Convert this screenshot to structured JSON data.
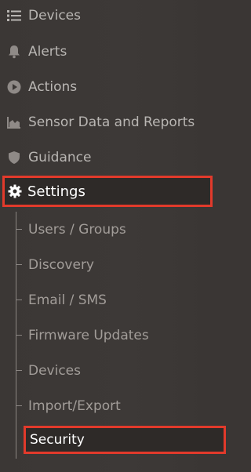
{
  "nav": {
    "items": [
      {
        "label": "Devices",
        "icon": "list-icon"
      },
      {
        "label": "Alerts",
        "icon": "bell-icon"
      },
      {
        "label": "Actions",
        "icon": "play-circle-icon"
      },
      {
        "label": "Sensor Data and Reports",
        "icon": "area-chart-icon"
      },
      {
        "label": "Guidance",
        "icon": "shield-icon"
      },
      {
        "label": "Settings",
        "icon": "gear-icon",
        "active": true
      }
    ]
  },
  "settings_sub": {
    "items": [
      {
        "label": "Users / Groups"
      },
      {
        "label": "Discovery"
      },
      {
        "label": "Email / SMS"
      },
      {
        "label": "Firmware Updates"
      },
      {
        "label": "Devices"
      },
      {
        "label": "Import/Export"
      },
      {
        "label": "Security",
        "active": true
      }
    ]
  },
  "colors": {
    "background": "#3a3634",
    "text": "#b9b6b3",
    "active_text": "#ffffff",
    "highlight_border": "#e23a2b"
  }
}
